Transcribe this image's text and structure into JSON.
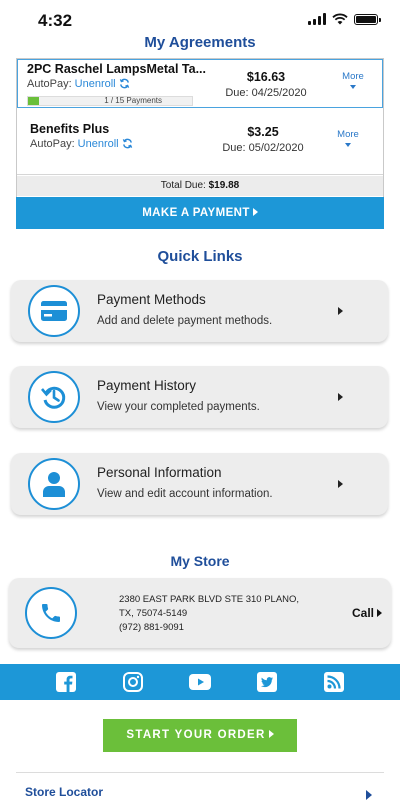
{
  "status_bar": {
    "time": "4:32"
  },
  "agreements": {
    "title": "My Agreements",
    "items": [
      {
        "name": "2PC Raschel LampsMetal Ta...",
        "autopay_label": "AutoPay:",
        "autopay_action": "Unenroll",
        "amount": "$16.63",
        "due": "Due: 04/25/2020",
        "more_label": "More",
        "progress_text": "1 / 15 Payments",
        "progress_fraction": 0.067
      },
      {
        "name": "Benefits Plus",
        "autopay_label": "AutoPay:",
        "autopay_action": "Unenroll",
        "amount": "$3.25",
        "due": "Due: 05/02/2020",
        "more_label": "More"
      }
    ],
    "total_label": "Total Due:",
    "total_value": "$19.88",
    "make_payment_label": "MAKE A PAYMENT"
  },
  "quick_links": {
    "title": "Quick Links",
    "items": [
      {
        "title": "Payment Methods",
        "description": "Add and delete payment methods.",
        "icon": "credit-card-icon"
      },
      {
        "title": "Payment History",
        "description": "View your completed payments.",
        "icon": "history-icon"
      },
      {
        "title": "Personal Information",
        "description": "View and edit account information.",
        "icon": "person-icon"
      }
    ]
  },
  "store": {
    "title": "My Store",
    "address_line1": "2380 EAST PARK BLVD STE 310 PLANO,",
    "address_line2": "TX, 75074-5149",
    "phone": "(972) 881-9091",
    "call_label": "Call",
    "icon": "phone-icon"
  },
  "social": [
    "facebook-icon",
    "instagram-icon",
    "youtube-icon",
    "twitter-icon",
    "rss-icon"
  ],
  "colors": {
    "brand_blue": "#1d97d7",
    "title_blue": "#1f4e9a",
    "link_blue": "#2a88d8",
    "cta_green": "#6bbf3a"
  },
  "start_order_label": "START YOUR ORDER",
  "store_locator_label": "Store Locator"
}
